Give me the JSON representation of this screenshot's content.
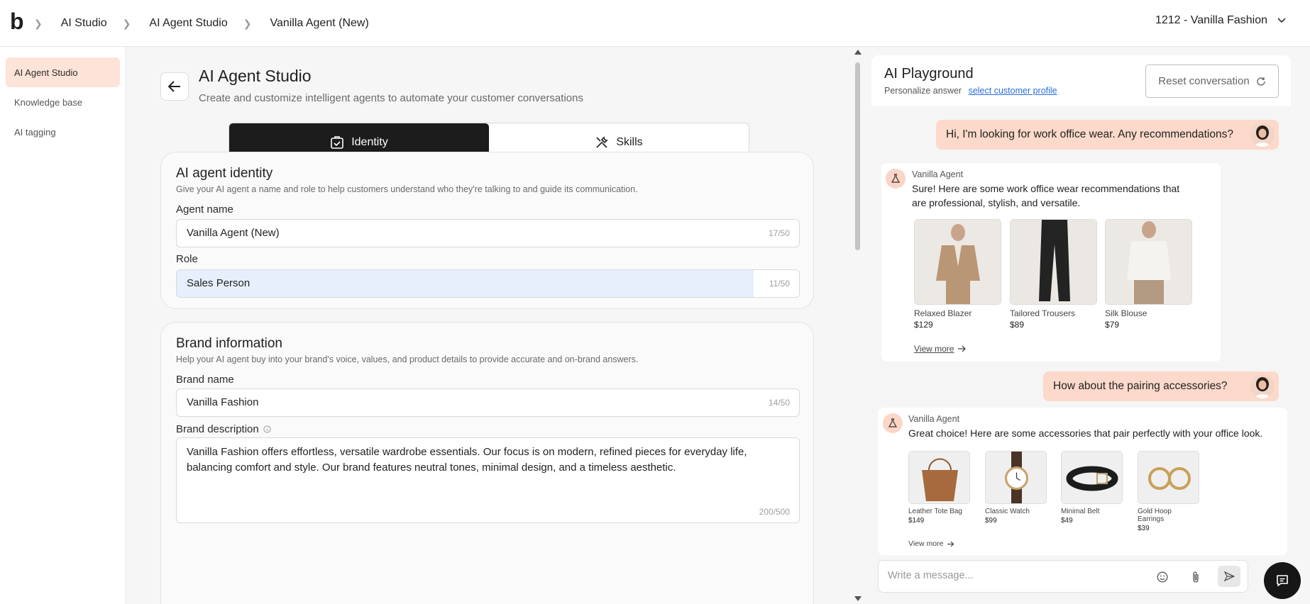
{
  "topbar": {
    "logo": "b",
    "breadcrumbs": [
      "AI Studio",
      "AI Agent Studio",
      "Vanilla Agent (New)"
    ],
    "store_selector": "1212 - Vanilla Fashion"
  },
  "sidebar": {
    "items": [
      {
        "label": "AI Agent Studio",
        "active": true
      },
      {
        "label": "Knowledge base",
        "active": false
      },
      {
        "label": "AI tagging",
        "active": false
      }
    ]
  },
  "main": {
    "title": "AI Agent Studio",
    "subtitle": "Create and customize intelligent agents to automate your customer conversations",
    "tabs": [
      {
        "label": "Identity",
        "active": true,
        "icon": "id-badge-icon"
      },
      {
        "label": "Skills",
        "active": false,
        "icon": "tools-icon"
      }
    ],
    "identity": {
      "title": "AI agent identity",
      "description": "Give your AI agent a name and role to help customers understand who they're talking to and guide its communication.",
      "agent_name_label": "Agent name",
      "agent_name_value": "Vanilla Agent (New)",
      "agent_name_count": "17/50",
      "role_label": "Role",
      "role_value": "Sales Person",
      "role_count": "11/50"
    },
    "brand": {
      "title": "Brand information",
      "description": "Help your AI agent buy into your brand's voice, values, and product details to provide accurate and on-brand answers.",
      "brand_name_label": "Brand name",
      "brand_name_value": "Vanilla Fashion",
      "brand_name_count": "14/50",
      "brand_desc_label": "Brand description",
      "brand_desc_value": "Vanilla Fashion offers effortless, versatile wardrobe essentials. Our focus is on modern, refined pieces for everyday life, balancing comfort and style. Our brand features neutral tones, minimal design, and a timeless aesthetic.",
      "brand_desc_count": "200/500"
    }
  },
  "playground": {
    "title": "AI Playground",
    "personalize_label": "Personalize answer",
    "personalize_link": "select customer profile",
    "reset_label": "Reset conversation",
    "messages": [
      {
        "from": "user",
        "text": "Hi, I'm looking for work office wear. Any recommendations?"
      },
      {
        "from": "agent",
        "name": "Vanilla Agent",
        "text": "Sure! Here are some work office wear recommendations that are professional, stylish, and versatile.",
        "products": [
          {
            "name": "Relaxed Blazer",
            "price": "$129"
          },
          {
            "name": "Tailored Trousers",
            "price": "$89"
          },
          {
            "name": "Silk Blouse",
            "price": "$79"
          }
        ],
        "view_more": "View more"
      },
      {
        "from": "user",
        "text": "How about the pairing accessories?"
      },
      {
        "from": "agent",
        "name": "Vanilla Agent",
        "text": "Great choice! Here are some accessories that pair perfectly with your office look.",
        "products": [
          {
            "name": "Leather Tote Bag",
            "price": "$149"
          },
          {
            "name": "Classic Watch",
            "price": "$99"
          },
          {
            "name": "Minimal Belt",
            "price": "$49"
          },
          {
            "name": "Gold Hoop Earrings",
            "price": "$39"
          }
        ],
        "view_more": "View more"
      }
    ],
    "composer_placeholder": "Write a message..."
  },
  "colors": {
    "accent_peach": "#fcd9ca",
    "sidebar_active": "#fde3d8",
    "tab_active": "#1c1c1c",
    "link_blue": "#2a6fd6",
    "role_highlight": "#e6effb"
  }
}
